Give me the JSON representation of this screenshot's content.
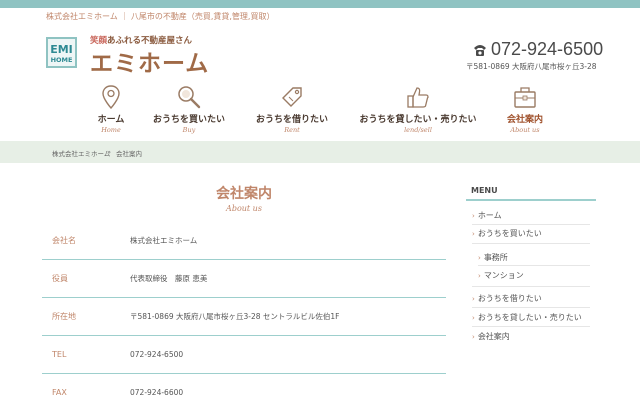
{
  "header": {
    "tagline": "株式会社エミホーム ｜ 八尾市の不動産（売買,賃貸,管理,買取）",
    "logo_badge_top": "EMI",
    "logo_badge_bottom": "HOME",
    "logo_catch_a": "笑顔",
    "logo_catch_b": "あふれる不動産屋さん",
    "logo_name": "エミホーム",
    "phone": "072-924-6500",
    "address": "〒581-0869 大阪府八尾市桜ヶ丘3-28"
  },
  "nav": [
    {
      "jp": "ホーム",
      "en": "Home",
      "icon": "map-pin-icon"
    },
    {
      "jp": "おうちを買いたい",
      "en": "Buy",
      "icon": "magnifier-icon"
    },
    {
      "jp": "おうちを借りたい",
      "en": "Rent",
      "icon": "price-tag-icon"
    },
    {
      "jp": "おうちを貸したい・売りたい",
      "en": "lend/sell",
      "icon": "thumbs-up-icon"
    },
    {
      "jp": "会社案内",
      "en": "About us",
      "icon": "briefcase-icon"
    }
  ],
  "breadcrumb": {
    "home": "株式会社エミホーム",
    "sep": "»",
    "current": "会社案内"
  },
  "page": {
    "title": "会社案内",
    "subtitle": "About us"
  },
  "company_table": [
    {
      "label": "会社名",
      "value": "株式会社エミホーム"
    },
    {
      "label": "役員",
      "value": "代表取締役　藤原 恵美"
    },
    {
      "label": "所在地",
      "value": "〒581-0869 大阪府八尾市桜ヶ丘3-28 セントラルビル佐伯1F"
    },
    {
      "label": "TEL",
      "value": "072-924-6500"
    },
    {
      "label": "FAX",
      "value": "072-924-6600"
    }
  ],
  "sidebar": {
    "heading": "MENU",
    "items": [
      {
        "label": "ホーム"
      },
      {
        "label": "おうちを買いたい"
      },
      {
        "label": "事務所"
      },
      {
        "label": "マンション"
      },
      {
        "label": "おうちを借りたい"
      },
      {
        "label": "おうちを貸したい・売りたい"
      },
      {
        "label": "会社案内"
      }
    ]
  },
  "colors": {
    "accent_teal": "#8fc3c2",
    "accent_brown": "#c0866a",
    "logo_brown": "#a06a47",
    "breadcrumb_bg": "#e7efe6"
  }
}
